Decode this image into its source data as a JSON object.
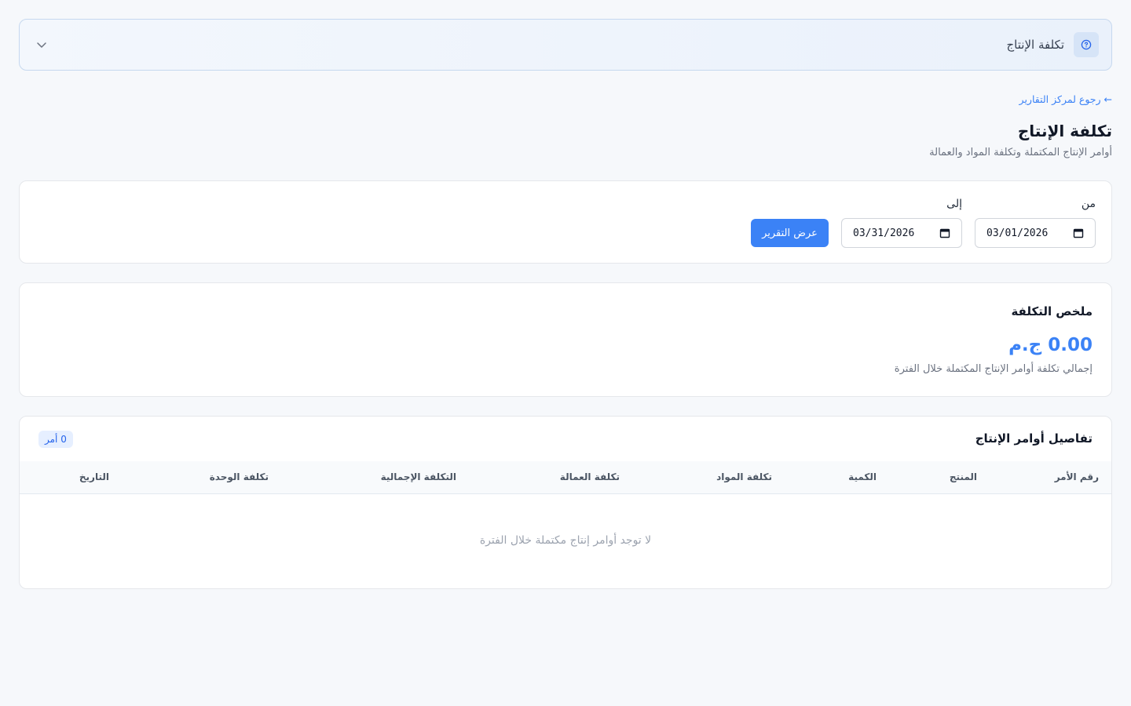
{
  "help_bar": {
    "title": "تكلفة الإنتاج",
    "help_icon": "question-circle-icon",
    "toggle_icon": "chevron-down-icon"
  },
  "back_link": "← رجوع لمركز التقارير",
  "page": {
    "title": "تكلفة الإنتاج",
    "subtitle": "أوامر الإنتاج المكتملة وتكلفة المواد والعمالة"
  },
  "filter": {
    "from_label": "من",
    "from_value": "03/01/2026",
    "to_label": "إلى",
    "to_value": "03/31/2026",
    "submit_label": "عرض التقرير",
    "calendar_icon": "calendar-icon"
  },
  "summary": {
    "heading": "ملخص التكلفة",
    "amount": "0.00 ج.م",
    "caption": "إجمالي تكلفة أوامر الإنتاج المكتملة خلال الفترة"
  },
  "details": {
    "heading": "تفاصيل أوامر الإنتاج",
    "count_badge": "0 أمر",
    "columns": [
      "رقم الأمر",
      "المنتج",
      "الكمية",
      "تكلفة المواد",
      "تكلفة العمالة",
      "التكلفة الإجمالية",
      "تكلفة الوحدة",
      "التاريخ"
    ],
    "rows": [],
    "empty_message": "لا توجد أوامر إنتاج مكتملة خلال الفترة"
  },
  "colors": {
    "accent": "#3b82f6",
    "background": "#f6f8fb",
    "help_bar_border": "#c6d8ef"
  }
}
